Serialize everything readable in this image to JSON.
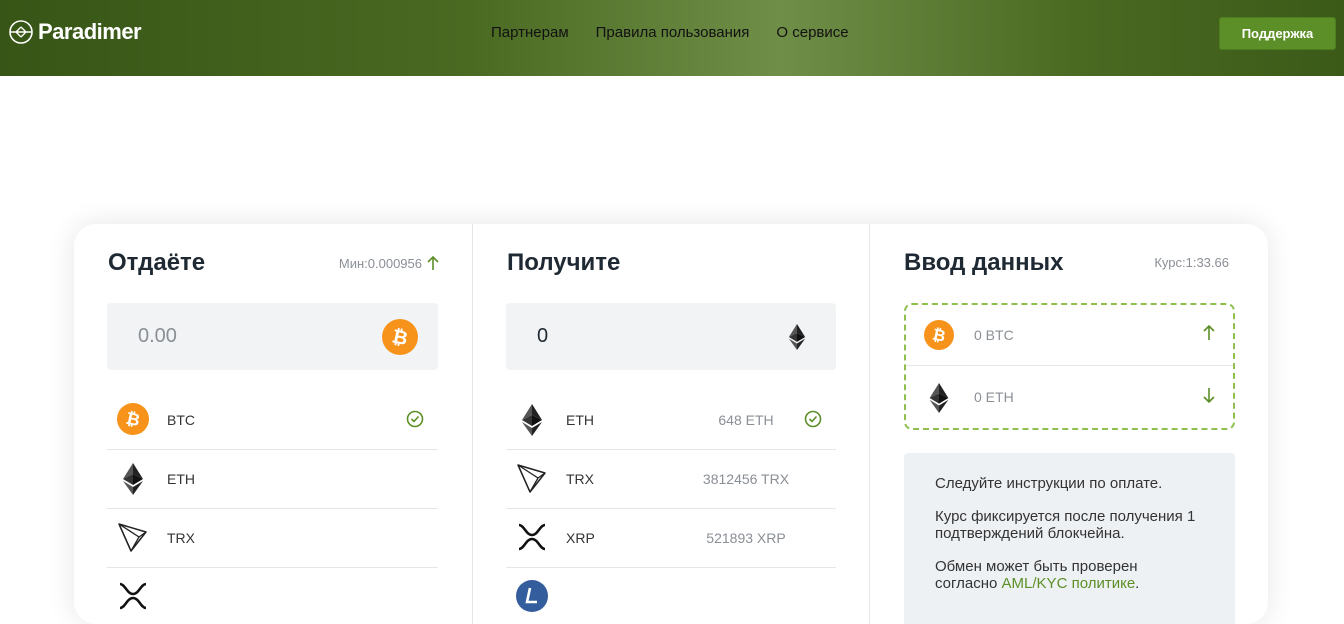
{
  "header": {
    "brand": "Paradimer",
    "nav": [
      "Партнерам",
      "Правила пользования",
      "О сервисе"
    ],
    "support_label": "Поддержка"
  },
  "give": {
    "title": "Отдаёте",
    "min_label": "Мин:0.000956",
    "amount": "0.00",
    "selected_coin": "btc-icon",
    "items": [
      {
        "symbol": "BTC",
        "icon": "btc-icon",
        "selected": true
      },
      {
        "symbol": "ETH",
        "icon": "eth-icon",
        "selected": false
      },
      {
        "symbol": "TRX",
        "icon": "trx-icon",
        "selected": false
      }
    ]
  },
  "receive": {
    "title": "Получите",
    "amount": "0",
    "selected_coin": "eth-icon",
    "items": [
      {
        "symbol": "ETH",
        "reserve": "648 ETH",
        "icon": "eth-icon",
        "selected": true
      },
      {
        "symbol": "TRX",
        "reserve": "3812456 TRX",
        "icon": "trx-icon",
        "selected": false
      },
      {
        "symbol": "XRP",
        "reserve": "521893 XRP",
        "icon": "xrp-icon",
        "selected": false
      }
    ]
  },
  "data_entry": {
    "title": "Ввод данных",
    "rate_label": "Курс:1:33.66",
    "give_amount": "0 BTC",
    "receive_amount": "0 ETH",
    "instructions": [
      "Следуйте инструкции по оплате.",
      "Курс фиксируется после получения 1 подтверждений блокчейна."
    ],
    "aml_prefix": "Обмен может быть проверен согласно",
    "aml_link": "AML/KYC политике",
    "aml_suffix": "."
  },
  "colors": {
    "accent": "#5c8f27",
    "btc": "#f7931a",
    "dashed_border": "#8fc04d"
  }
}
